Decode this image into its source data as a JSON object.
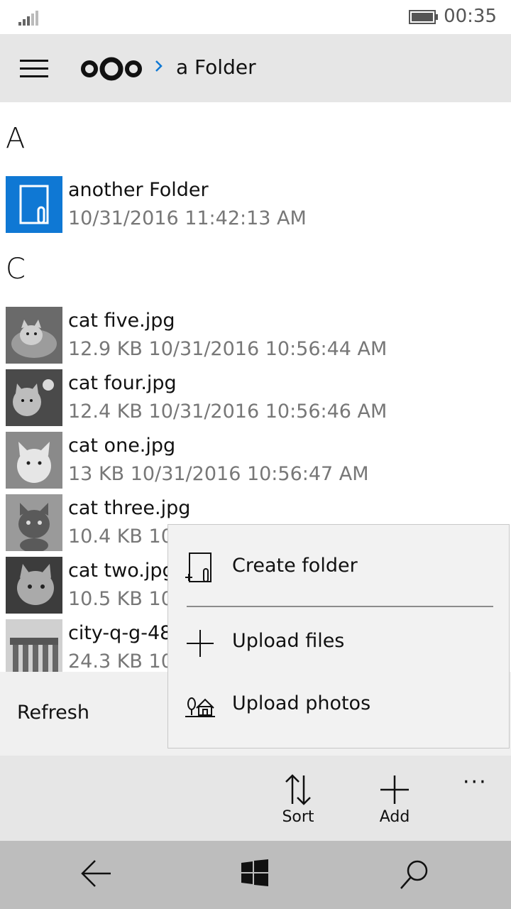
{
  "status": {
    "time": "00:35"
  },
  "header": {
    "breadcrumb_title": "a Folder"
  },
  "groups": [
    {
      "letter": "A"
    },
    {
      "letter": "C"
    }
  ],
  "folders": [
    {
      "name": "another Folder",
      "modified": "10/31/2016 11:42:13 AM"
    }
  ],
  "files": [
    {
      "name": "cat five.jpg",
      "meta": "12.9 KB  10/31/2016 10:56:44 AM"
    },
    {
      "name": "cat four.jpg",
      "meta": "12.4 KB  10/31/2016 10:56:46 AM"
    },
    {
      "name": "cat one.jpg",
      "meta": "13 KB  10/31/2016 10:56:47 AM"
    },
    {
      "name": "cat three.jpg",
      "meta": "10.4 KB  10"
    },
    {
      "name": "cat two.jpg",
      "meta": "10.5 KB  10"
    },
    {
      "name": "city-q-g-48",
      "meta": "24.3 KB  10"
    }
  ],
  "command_bar": {
    "refresh_label": "Refresh",
    "sort_label": "Sort",
    "add_label": "Add",
    "more_label": "···"
  },
  "add_menu": {
    "create_folder": "Create folder",
    "upload_files": "Upload files",
    "upload_photos": "Upload photos"
  },
  "colors": {
    "accent": "#0f78d4",
    "header_bg": "#e6e6e6",
    "nav_bg": "#bdbdbd"
  }
}
